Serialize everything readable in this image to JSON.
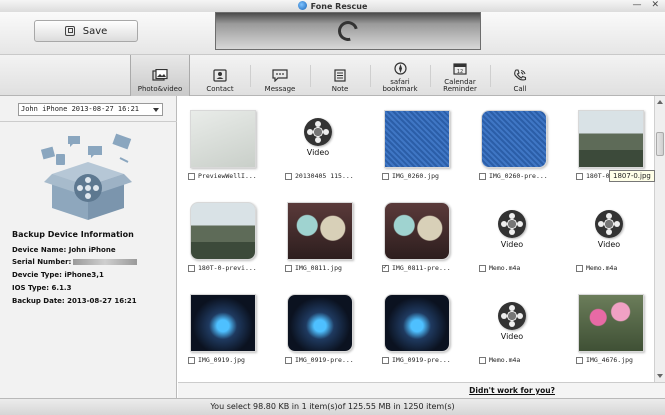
{
  "window": {
    "title": "Fone Rescue",
    "minimize": "—",
    "close": "✕"
  },
  "header": {
    "save_label": "Save"
  },
  "tabs": [
    {
      "label": "Photo&video",
      "icon": "photo-video-icon",
      "active": true
    },
    {
      "label": "Contact",
      "icon": "contact-icon"
    },
    {
      "label": "Message",
      "icon": "message-icon"
    },
    {
      "label": "Note",
      "icon": "note-icon"
    },
    {
      "label": "safari\nbookmark",
      "icon": "safari-bookmark-icon"
    },
    {
      "label": "Calendar\nReminder",
      "icon": "calendar-icon"
    },
    {
      "label": "Call",
      "icon": "call-icon"
    }
  ],
  "sidebar": {
    "device_select": "John iPhone  2013-08-27 16:21",
    "info_title": "Backup Device Information",
    "device_name": "Device Name: John iPhone",
    "serial_label": "Serial Number:",
    "device_type": "Devcie Type: iPhone3,1",
    "ios_type": "IOS Type: 6.1.3",
    "backup_date": "Backup Date: 2013-08-27 16:21"
  },
  "grid": {
    "video_label": "Video",
    "items": [
      {
        "name": "PreviewWellI...",
        "kind": "photo",
        "style": "doc",
        "checked": false
      },
      {
        "name": "20130405 115...",
        "kind": "video",
        "checked": false
      },
      {
        "name": "IMG_0260.jpg",
        "kind": "photo",
        "style": "blue",
        "checked": false
      },
      {
        "name": "IMG_0260-pre...",
        "kind": "photo",
        "style": "blue-rounded",
        "checked": false
      },
      {
        "name": "180T-0...",
        "kind": "photo",
        "style": "mountain",
        "checked": false
      },
      {
        "name": "180T-0-previ...",
        "kind": "photo",
        "style": "mountain-rounded",
        "checked": false
      },
      {
        "name": "IMG_0811.jpg",
        "kind": "photo",
        "style": "bowls",
        "checked": false
      },
      {
        "name": "IMG_0811-pre...",
        "kind": "photo",
        "style": "bowls-rounded",
        "checked": true
      },
      {
        "name": "Memo.m4a",
        "kind": "video",
        "checked": false
      },
      {
        "name": "Memo.m4a",
        "kind": "video",
        "checked": false
      },
      {
        "name": "IMG_0919.jpg",
        "kind": "photo",
        "style": "mouse",
        "checked": false
      },
      {
        "name": "IMG_0919-pre...",
        "kind": "photo",
        "style": "mouse-rounded",
        "checked": false
      },
      {
        "name": "IMG_0919-pre...",
        "kind": "photo",
        "style": "mouse-rounded",
        "checked": false
      },
      {
        "name": "Memo.m4a",
        "kind": "video",
        "checked": false
      },
      {
        "name": "IMG_4676.jpg",
        "kind": "photo",
        "style": "flowers",
        "checked": false
      }
    ]
  },
  "tooltip": "1807-0.jpg",
  "footer": {
    "help_link": "Didn't work for you?",
    "status": "You select 98.80 KB in 1 item(s)of 125.55 MB in 1250 item(s)"
  },
  "colors": {
    "accent": "#1763b6",
    "toolbar_bg": "#e6e6e6",
    "panel_bg": "#f2f2f2"
  }
}
